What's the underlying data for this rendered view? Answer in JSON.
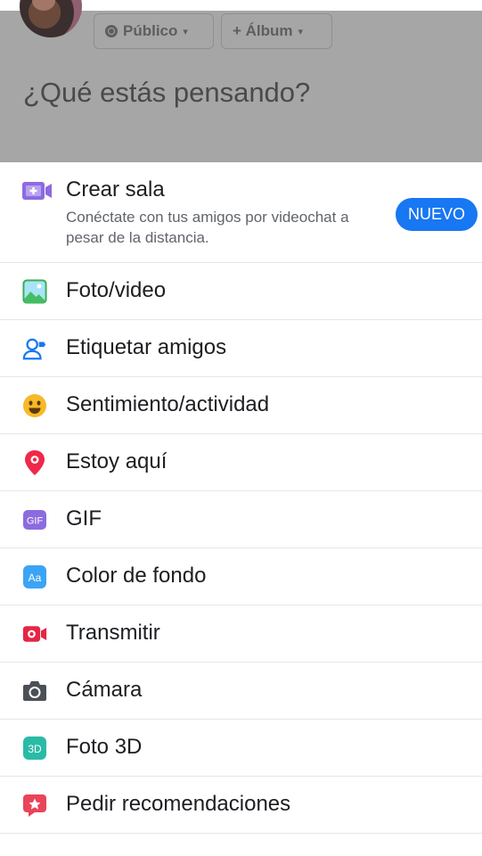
{
  "composer": {
    "privacy_label": "Público",
    "album_label": "+ Álbum",
    "caret": "▾",
    "prompt": "¿Qué estás pensando?"
  },
  "room": {
    "title": "Crear sala",
    "description": "Conéctate con tus amigos por videochat a pesar de la distancia.",
    "badge": "NUEVO",
    "icon": "video-room-icon"
  },
  "menu": [
    {
      "label": "Foto/video",
      "icon": "photo-video-icon"
    },
    {
      "label": "Etiquetar amigos",
      "icon": "tag-friends-icon"
    },
    {
      "label": "Sentimiento/actividad",
      "icon": "smiley-icon"
    },
    {
      "label": "Estoy aquí",
      "icon": "location-pin-icon"
    },
    {
      "label": "GIF",
      "icon": "gif-icon"
    },
    {
      "label": "Color de fondo",
      "icon": "background-color-icon"
    },
    {
      "label": "Transmitir",
      "icon": "live-video-icon"
    },
    {
      "label": "Cámara",
      "icon": "camera-icon"
    },
    {
      "label": "Foto 3D",
      "icon": "3d-photo-icon"
    },
    {
      "label": "Pedir recomendaciones",
      "icon": "recommendation-icon"
    }
  ],
  "colors": {
    "accent": "#1877f2",
    "overlay": "#a6a6a6",
    "divider": "#e4e6eb"
  }
}
